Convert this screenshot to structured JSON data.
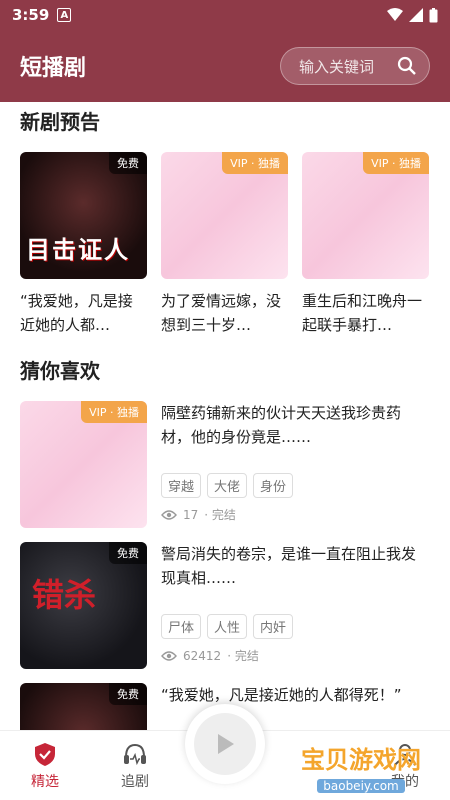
{
  "status_bar": {
    "time": "3:59",
    "a_label": "A"
  },
  "app_bar": {
    "title": "短播剧",
    "search_placeholder": "输入关键词"
  },
  "preview": {
    "title": "新剧预告",
    "items": [
      {
        "badge": "免费",
        "badge_type": "free",
        "cover_text": "目击证人",
        "text": "“我爱她，凡是接近她的人都…"
      },
      {
        "badge": "VIP · 独播",
        "badge_type": "vip",
        "text": "为了爱情远嫁，没想到三十岁…"
      },
      {
        "badge": "VIP · 独播",
        "badge_type": "vip",
        "text": "重生后和江晚舟一起联手暴打…"
      }
    ]
  },
  "recommend": {
    "title": "猜你喜欢",
    "items": [
      {
        "badge": "VIP · 独播",
        "desc": "隔壁药铺新来的伙计天天送我珍贵药材，他的身份竟是……",
        "tags": [
          "穿越",
          "大佬",
          "身份"
        ],
        "views": "17",
        "status": "· 完结"
      },
      {
        "badge": "免费",
        "cover_text": "错杀",
        "desc": "警局消失的卷宗，是谁一直在阻止我发现真相……",
        "tags": [
          "尸体",
          "人性",
          "内奸"
        ],
        "views": "62412",
        "status": "· 完结"
      },
      {
        "badge": "免费",
        "desc": "“我爱她，凡是接近她的人都得死！”"
      }
    ]
  },
  "bottom_nav": {
    "items": [
      {
        "label": "精选"
      },
      {
        "label": "追剧"
      },
      {
        "label": "我的"
      }
    ]
  },
  "watermark": {
    "title": "宝贝游戏网",
    "url": "baobeiy.com"
  },
  "colors": {
    "brand": "#8f3a48",
    "active": "#c62638",
    "vip": "#f3a54a"
  }
}
